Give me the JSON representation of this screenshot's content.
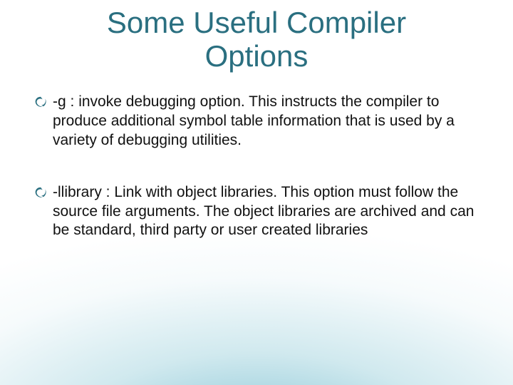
{
  "title_line1": "Some Useful Compiler",
  "title_line2": "Options",
  "bullets": [
    {
      "option": "-g",
      "text": " :  invoke debugging option. This instructs the compiler to produce additional symbol table information that is used by a variety of debugging utilities."
    },
    {
      "option": "-llibrary",
      "text": " :  Link with object libraries. This option must follow the source file arguments. The object libraries are archived and can be standard, third party or user created libraries"
    }
  ]
}
